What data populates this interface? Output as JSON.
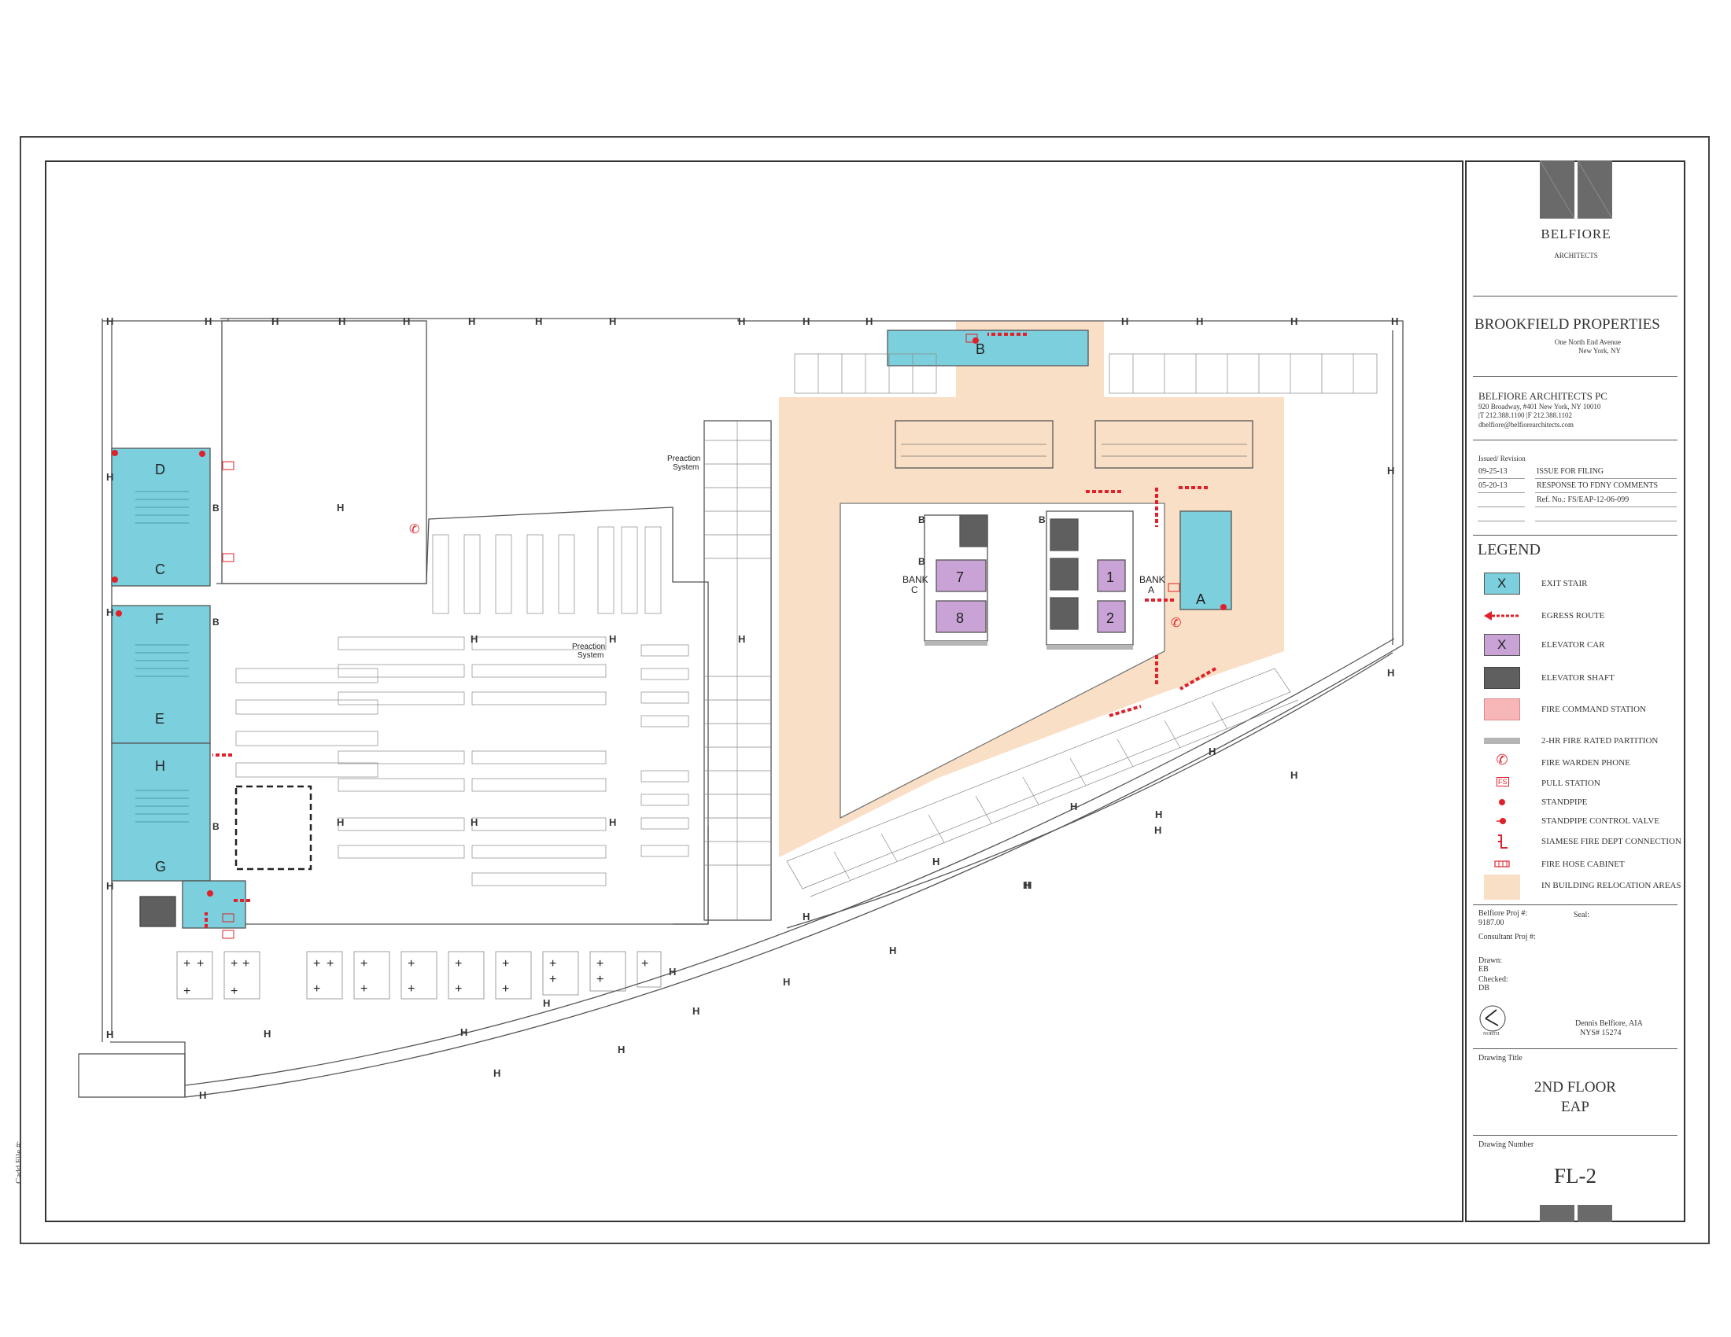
{
  "colors": {
    "exit_stair": "#7ccfdc",
    "egress_route": "#e0202a",
    "elevator_car": "#c9a3d6",
    "elevator_shaft": "#5f5f5f",
    "fire_command_station": "#f7b6b8",
    "fire_rated_partition": "#b5b5b5",
    "relocation_area": "#f9dfc5",
    "line": "#555555"
  },
  "title_block": {
    "firm_name": "BELFIORE",
    "firm_sub": "ARCHITECTS",
    "client": "BROOKFIELD PROPERTIES",
    "client_addr1": "One North End Avenue",
    "client_addr2": "New York, NY",
    "architect_name": "BELFIORE ARCHITECTS PC",
    "architect_addr": "920 Broadway, #401   New York, NY 10010",
    "architect_phone": "|T  212.388.1100   |F  212.388.1102",
    "architect_email": "dbelfiore@belfiorearchitects.com",
    "issued_label": "Issued/ Revision",
    "revisions": [
      {
        "date": "09-25-13",
        "desc": "ISSUE FOR FILING"
      },
      {
        "date": "05-20-13",
        "desc": "RESPONSE TO FDNY COMMENTS"
      }
    ],
    "ref_no": "Ref. No.: FS/EAP-12-06-099",
    "legend_title": "LEGEND",
    "legend": [
      {
        "key": "exit_stair",
        "label": "EXIT STAIR",
        "mark": "X"
      },
      {
        "key": "egress_route",
        "label": "EGRESS ROUTE"
      },
      {
        "key": "elevator_car",
        "label": "ELEVATOR CAR",
        "mark": "X"
      },
      {
        "key": "elevator_shaft",
        "label": "ELEVATOR SHAFT"
      },
      {
        "key": "fire_command_station",
        "label": "FIRE COMMAND STATION"
      },
      {
        "key": "fire_rated_partition",
        "label": "2-HR FIRE RATED PARTITION"
      },
      {
        "key": "fire_warden_phone",
        "label": "FIRE WARDEN PHONE"
      },
      {
        "key": "pull_station",
        "label": "PULL STATION",
        "mark": "FS"
      },
      {
        "key": "standpipe",
        "label": "STANDPIPE"
      },
      {
        "key": "standpipe_control_valve",
        "label": "STANDPIPE CONTROL VALVE"
      },
      {
        "key": "siamese",
        "label": "SIAMESE FIRE DEPT CONNECTION"
      },
      {
        "key": "fire_hose_cabinet",
        "label": "FIRE HOSE CABINET"
      },
      {
        "key": "relocation_area",
        "label": "IN BUILDING RELOCATION AREAS"
      }
    ],
    "proj_label": "Belfiore Proj #:",
    "proj_value": "9187.00",
    "seal_label": "Seal:",
    "consultant_label": "Consultant Proj #:",
    "drawn_label": "Drawn:",
    "drawn_value": "EB",
    "checked_label": "Checked:",
    "checked_value": "DB",
    "north_label": "NORTH",
    "signer_name": "Dennis Belfiore, AIA",
    "signer_license": "NYS# 15274",
    "drawing_title_label": "Drawing Title",
    "drawing_title_1": "2ND FLOOR",
    "drawing_title_2": "EAP",
    "drawing_number_label": "Drawing Number",
    "drawing_number": "FL-2"
  },
  "cadd_file_label": "Cadd File #:",
  "plan": {
    "stairs": [
      "D",
      "C",
      "F",
      "E",
      "H",
      "G",
      "B",
      "A"
    ],
    "elevator_cars": [
      "7",
      "8",
      "1",
      "2"
    ],
    "bank_c": [
      "BANK",
      "C"
    ],
    "bank_a": [
      "BANK",
      "A"
    ],
    "preaction_1": [
      "Preaction",
      "System"
    ],
    "preaction_2": [
      "Preaction",
      "System"
    ],
    "pull_station_mark": "FS",
    "column_mark": "H",
    "stand_mark": "B"
  }
}
